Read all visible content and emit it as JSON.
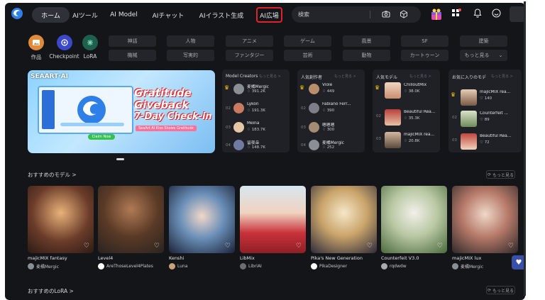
{
  "nav": {
    "home": "ホーム",
    "tools": "AIツール",
    "model": "AI Model",
    "chat": "AIチャット",
    "illust": "AIイラスト生成",
    "square": "AI広場"
  },
  "search": {
    "placeholder": "検索"
  },
  "categories": {
    "works": "作品",
    "checkpoint": "Checkpoint",
    "lora": "LoRA"
  },
  "tags": [
    "神話",
    "人物",
    "アニメ",
    "ゲーム",
    "風景",
    "SF",
    "建築",
    "機械",
    "写実的",
    "ファンタジー",
    "芸術",
    "動物",
    "カートゥーン",
    "もっと見る"
  ],
  "banner": {
    "brand": "SEAART·AI",
    "title1": "Gratitude",
    "title2": "Giveback",
    "title3": "7-Day Check-in",
    "subtitle": "SeaArt AI  Kiss Shows Gratitude",
    "claim": "Claim Now"
  },
  "rankings": {
    "more": "もっと見る >",
    "creators": {
      "title": "Model Creators",
      "rows": [
        {
          "rank": "",
          "name": "麦橘Mergic",
          "stat": "391.2K"
        },
        {
          "rank": "02",
          "name": "Lykon",
          "stat": "191.3K"
        },
        {
          "rank": "03",
          "name": "Meina",
          "stat": "183.7K"
        },
        {
          "rank": "04",
          "name": "留夜朵",
          "stat": "148.7K"
        }
      ]
    },
    "artists": {
      "title": "人気創作者",
      "rows": [
        {
          "rank": "",
          "name": "Viole",
          "stat": "449"
        },
        {
          "rank": "02",
          "name": "Fabiano Ferr...",
          "stat": "390"
        },
        {
          "rank": "03",
          "name": "嗯嗯嗯",
          "stat": "300"
        },
        {
          "rank": "04",
          "name": "麦橘Mergic",
          "stat": "252"
        }
      ]
    },
    "models": {
      "title": "人気モデル",
      "rows": [
        {
          "rank": "",
          "name": "ChilloutMix",
          "stat": "38.0K"
        },
        {
          "rank": "02",
          "name": "Beautiful Rea...",
          "stat": "35.3K"
        },
        {
          "rank": "03",
          "name": "majicMIX rea...",
          "stat": "20.8K"
        }
      ]
    },
    "favorites": {
      "title": "お気に入りのモデ",
      "rows": [
        {
          "rank": "",
          "name": "majicMIX rea...",
          "stat": "140"
        },
        {
          "rank": "02",
          "name": "Counterfeit ...",
          "stat": "89"
        },
        {
          "rank": "03",
          "name": "Beautiful Rea...",
          "stat": "72"
        }
      ]
    }
  },
  "recommended": {
    "title": "おすすめのモデル  >",
    "more": "もっと見る",
    "items": [
      {
        "name": "majicMIX fantasy",
        "author": "麦橘Mergic"
      },
      {
        "name": "Level4",
        "author": "AreThoseLevel4Plates"
      },
      {
        "name": "Kenshi",
        "author": "Luna"
      },
      {
        "name": "LibMix",
        "author": "LibriAI"
      },
      {
        "name": "Pika's New Generation",
        "author": "PikaDesigner"
      },
      {
        "name": "Counterfeit V3.0",
        "author": "rqdwdw"
      },
      {
        "name": "majicMIX lux",
        "author": "麦橘Mergic"
      }
    ]
  },
  "lora": {
    "title": "おすすめのLoRA  >",
    "more": "もっと見る"
  },
  "colors": {
    "bg": "#141519",
    "card": "#202127",
    "accent": "#e0232a",
    "fab": "#3a4fa8"
  }
}
